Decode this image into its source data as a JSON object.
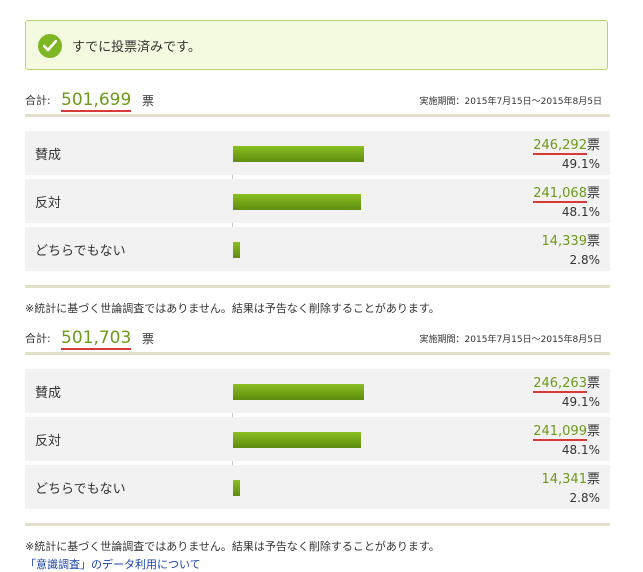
{
  "voted_message": "すでに投票済みです。",
  "accent_color": "#7fb624",
  "panels": [
    {
      "total_label": "合計:",
      "total_value": "501,699",
      "total_unit": "票",
      "period": "実施期間：2015年7月15日〜2015年8月5日",
      "options": [
        {
          "label": "賛成",
          "votes": "246,292",
          "unit": "票",
          "percent": "49.1%",
          "share": 0.491,
          "underlined": true
        },
        {
          "label": "反対",
          "votes": "241,068",
          "unit": "票",
          "percent": "48.1%",
          "share": 0.481,
          "underlined": true
        },
        {
          "label": "どちらでもない",
          "votes": "14,339",
          "unit": "票",
          "percent": "2.8%",
          "share": 0.028,
          "underlined": false
        }
      ],
      "note": "※統計に基づく世論調査ではありません。結果は予告なく削除することがあります。"
    },
    {
      "total_label": "合計:",
      "total_value": "501,703",
      "total_unit": "票",
      "period": "実施期間：2015年7月15日〜2015年8月5日",
      "options": [
        {
          "label": "賛成",
          "votes": "246,263",
          "unit": "票",
          "percent": "49.1%",
          "share": 0.491,
          "underlined": true
        },
        {
          "label": "反対",
          "votes": "241,099",
          "unit": "票",
          "percent": "48.1%",
          "share": 0.481,
          "underlined": true
        },
        {
          "label": "どちらでもない",
          "votes": "14,341",
          "unit": "票",
          "percent": "2.8%",
          "share": 0.028,
          "underlined": false
        }
      ],
      "note": "※統計に基づく世論調査ではありません。結果は予告なく削除することがあります。"
    }
  ],
  "footer_link": "「意識調査」のデータ利用について"
}
